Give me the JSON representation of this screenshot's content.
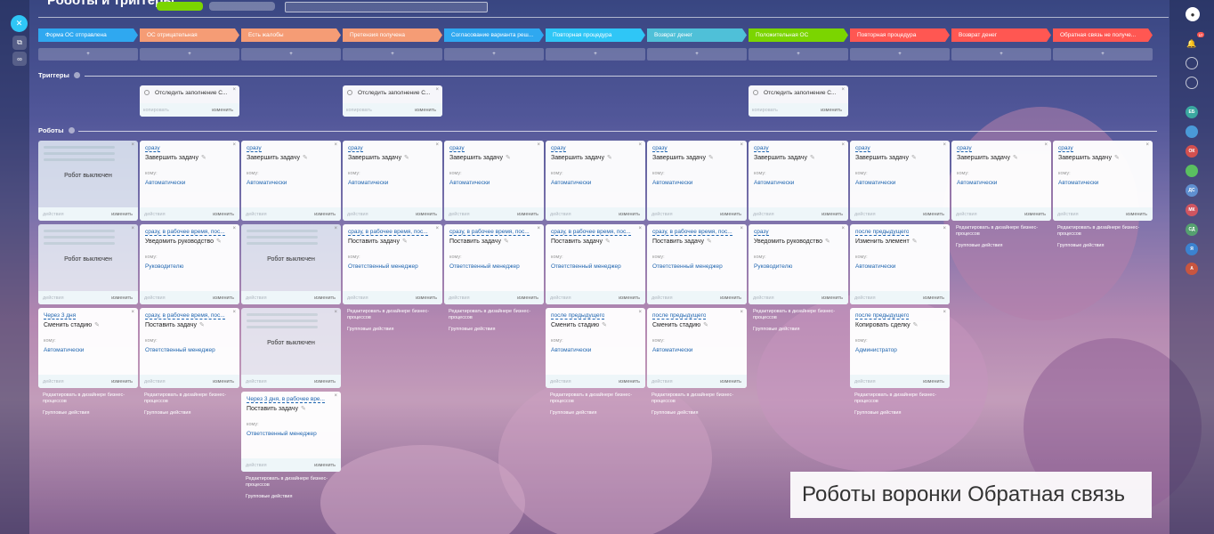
{
  "page": {
    "title": "Роботы и триггеры",
    "caption": "Роботы воронки Обратная связь"
  },
  "colors": {
    "stage_blue": "#2fa8f0",
    "stage_orange": "#f59c75",
    "stage_teal": "#4fc0d8",
    "stage_green": "#7bd500",
    "stage_red": "#ff5752",
    "link_blue": "#2066b0",
    "accent_cyan": "#2fc6f6"
  },
  "stages": [
    {
      "label": "Форма ОС отправлена",
      "color": "#2fa8f0"
    },
    {
      "label": "ОС отрицательная",
      "color": "#f59c75"
    },
    {
      "label": "Есть жалобы",
      "color": "#f59c75"
    },
    {
      "label": "Претензия получена",
      "color": "#f59c75"
    },
    {
      "label": "Согласование варианта реш...",
      "color": "#2fa8f0"
    },
    {
      "label": "Повторная процедура",
      "color": "#2fc6f6"
    },
    {
      "label": "Возврат денег",
      "color": "#4fc0d8"
    },
    {
      "label": "Положительная ОС",
      "color": "#7bd500"
    },
    {
      "label": "Повторная процедура",
      "color": "#ff5752"
    },
    {
      "label": "Возврат денег",
      "color": "#ff5752"
    },
    {
      "label": "Обратная связь не получе...",
      "color": "#ff5752"
    }
  ],
  "stage_add_symbol": "+",
  "sections": {
    "triggers": "Триггеры",
    "robots": "Роботы"
  },
  "triggers": [
    {
      "col": 1,
      "text": "Отследить заполнение С...",
      "copy": "копировать",
      "edit": "изменить"
    },
    {
      "col": 3,
      "text": "Отследить заполнение С...",
      "copy": "копировать",
      "edit": "изменить"
    },
    {
      "col": 7,
      "text": "Отследить заполнение С...",
      "copy": "копировать",
      "edit": "изменить"
    }
  ],
  "robot_labels": {
    "to": "кому:",
    "actions": "действия",
    "edit": "изменить",
    "disabled": "Робот выключен",
    "edit_in_designer": "Редактировать в дизайнере бизнес-процессов",
    "group_actions": "Групповые действия"
  },
  "robots": [
    {
      "col": 0,
      "row": 0,
      "disabled": true
    },
    {
      "col": 1,
      "row": 0,
      "when": "сразу",
      "title": "Завершить задачу",
      "who": "Автоматически"
    },
    {
      "col": 2,
      "row": 0,
      "when": "сразу",
      "title": "Завершить задачу",
      "who": "Автоматически"
    },
    {
      "col": 3,
      "row": 0,
      "when": "сразу",
      "title": "Завершить задачу",
      "who": "Автоматически"
    },
    {
      "col": 4,
      "row": 0,
      "when": "сразу",
      "title": "Завершить задачу",
      "who": "Автоматически"
    },
    {
      "col": 5,
      "row": 0,
      "when": "сразу",
      "title": "Завершить задачу",
      "who": "Автоматически"
    },
    {
      "col": 6,
      "row": 0,
      "when": "сразу",
      "title": "Завершить задачу",
      "who": "Автоматически"
    },
    {
      "col": 7,
      "row": 0,
      "when": "сразу",
      "title": "Завершить задачу",
      "who": "Автоматически"
    },
    {
      "col": 8,
      "row": 0,
      "when": "сразу",
      "title": "Завершить задачу",
      "who": "Автоматически"
    },
    {
      "col": 9,
      "row": 0,
      "when": "сразу",
      "title": "Завершить задачу",
      "who": "Автоматически"
    },
    {
      "col": 10,
      "row": 0,
      "when": "сразу",
      "title": "Завершить задачу",
      "who": "Автоматически"
    },
    {
      "col": 0,
      "row": 1,
      "disabled": true
    },
    {
      "col": 1,
      "row": 1,
      "when": "сразу, в рабочее время, пос...",
      "title": "Уведомить руководство",
      "who": "Руководителю"
    },
    {
      "col": 2,
      "row": 1,
      "disabled": true
    },
    {
      "col": 3,
      "row": 1,
      "when": "сразу, в рабочее время, пос...",
      "title": "Поставить задачу",
      "who": "Ответственный менеджер"
    },
    {
      "col": 4,
      "row": 1,
      "when": "сразу, в рабочее время, пос...",
      "title": "Поставить задачу",
      "who": "Ответственный менеджер"
    },
    {
      "col": 5,
      "row": 1,
      "when": "сразу, в рабочее время, пос...",
      "title": "Поставить задачу",
      "who": "Ответственный менеджер"
    },
    {
      "col": 6,
      "row": 1,
      "when": "сразу, в рабочее время, пос...",
      "title": "Поставить задачу",
      "who": "Ответственный менеджер"
    },
    {
      "col": 7,
      "row": 1,
      "when": "сразу",
      "title": "Уведомить руководство",
      "who": "Руководителю"
    },
    {
      "col": 8,
      "row": 1,
      "when": "после предыдущего",
      "title": "Изменить элемент",
      "who": "Автоматически"
    },
    {
      "col": 0,
      "row": 2,
      "when": "Через 3 дня",
      "title": "Сменить стадию",
      "who": "Автоматически"
    },
    {
      "col": 1,
      "row": 2,
      "when": "сразу, в рабочее время, пос...",
      "title": "Поставить задачу",
      "who": "Ответственный менеджер"
    },
    {
      "col": 2,
      "row": 2,
      "disabled": true
    },
    {
      "col": 5,
      "row": 2,
      "when": "после предыдущего",
      "title": "Сменить стадию",
      "who": "Автоматически"
    },
    {
      "col": 6,
      "row": 2,
      "when": "после предыдущего",
      "title": "Сменить стадию",
      "who": "Автоматически"
    },
    {
      "col": 8,
      "row": 2,
      "when": "после предыдущего",
      "title": "Копировать сделку",
      "who": "Администратор"
    },
    {
      "col": 2,
      "row": 3,
      "when": "Через 3 дня, в рабочее вре...",
      "title": "Поставить задачу",
      "who": "Ответственный менеджер"
    }
  ],
  "footers": [
    {
      "col": 0,
      "after_row": 2
    },
    {
      "col": 1,
      "after_row": 2
    },
    {
      "col": 2,
      "after_row": 3
    },
    {
      "col": 3,
      "after_row": 1
    },
    {
      "col": 4,
      "after_row": 1
    },
    {
      "col": 5,
      "after_row": 2
    },
    {
      "col": 6,
      "after_row": 2
    },
    {
      "col": 7,
      "after_row": 1
    },
    {
      "col": 8,
      "after_row": 2
    },
    {
      "col": 9,
      "after_row": 0
    },
    {
      "col": 10,
      "after_row": 0
    }
  ],
  "right_sidebar": [
    {
      "label": "ЕБ",
      "color": "#3aa7a0"
    },
    {
      "label": "",
      "color": "#4a9ad8"
    },
    {
      "label": "ОК",
      "color": "#d2504f"
    },
    {
      "label": "",
      "color": "#5abf60"
    },
    {
      "label": "ДС",
      "color": "#5f8fd0"
    },
    {
      "label": "МК",
      "color": "#d05560"
    },
    {
      "label": "СД",
      "color": "#55a070"
    },
    {
      "label": "Я",
      "color": "#3b82d0"
    },
    {
      "label": "А",
      "color": "#c8553f"
    }
  ],
  "notification_count": "17"
}
